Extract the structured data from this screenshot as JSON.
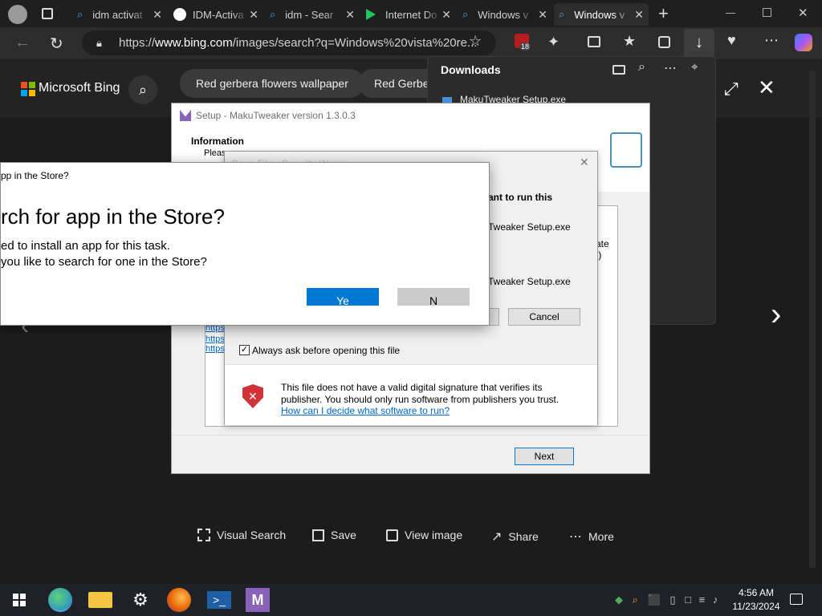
{
  "browser": {
    "tabs": [
      {
        "title": "idm activat",
        "icon": "bing-search-icon",
        "active": false
      },
      {
        "title": "IDM-Activa",
        "icon": "github-icon",
        "active": false
      },
      {
        "title": "idm - Sear",
        "icon": "bing-search-icon",
        "active": false
      },
      {
        "title": "Internet Do",
        "icon": "idm-flag-icon",
        "active": false
      },
      {
        "title": "Windows v",
        "icon": "bing-search-icon",
        "active": false
      },
      {
        "title": "Windows v",
        "icon": "bing-search-icon",
        "active": true
      }
    ],
    "url_prefix": "https://",
    "url_domain": "www.bing.com",
    "url_rest": "/images/search?q=Windows%20vista%20re...",
    "extension_badge": "18"
  },
  "bing": {
    "logo_text": "Microsoft Bing",
    "suggestions": [
      "Red gerbera flowers wallpaper",
      "Red Gerbera"
    ]
  },
  "downloads": {
    "title": "Downloads",
    "item": "MakuTweaker Setup.exe"
  },
  "setup": {
    "title": "Setup - MakuTweaker version 1.3.0.3",
    "header_title": "Information",
    "header_sub": "Please",
    "body_fragment": "ate :)",
    "links": [
      "https",
      "https",
      "https"
    ],
    "next_label": "Next"
  },
  "security": {
    "title_fragment": "Open File - Security Warning",
    "question_fragment": "ant to run this",
    "name_fragment": "Tweaker Setup.exe",
    "from_fragment": "Tweaker Setup.exe",
    "cancel_label": "Cancel",
    "checkbox_label": "Always ask before opening this file",
    "warning_text": "This file does not have a valid digital signature that verifies its publisher.  You should only run software from publishers you trust.",
    "help_link": "How can I decide what software to run?"
  },
  "store": {
    "title": "pp in the Store?",
    "heading": "rch for app in the Store?",
    "line1": "ed to install an app for this task.",
    "line2": "you like to search for one in the Store?",
    "yes_label": "Ye",
    "no_label": "N"
  },
  "actions": [
    {
      "label": "Visual Search",
      "icon": "visual-search-icon"
    },
    {
      "label": "Save",
      "icon": "save-icon"
    },
    {
      "label": "View image",
      "icon": "view-image-icon"
    },
    {
      "label": "Share",
      "icon": "share-icon"
    },
    {
      "label": "More",
      "icon": "more-icon"
    }
  ],
  "taskbar": {
    "time": "4:56 AM",
    "date": "11/23/2024"
  },
  "colors": {
    "accent_blue": "#0078d4",
    "security_red": "#d13438",
    "link_blue": "#0066cc"
  }
}
